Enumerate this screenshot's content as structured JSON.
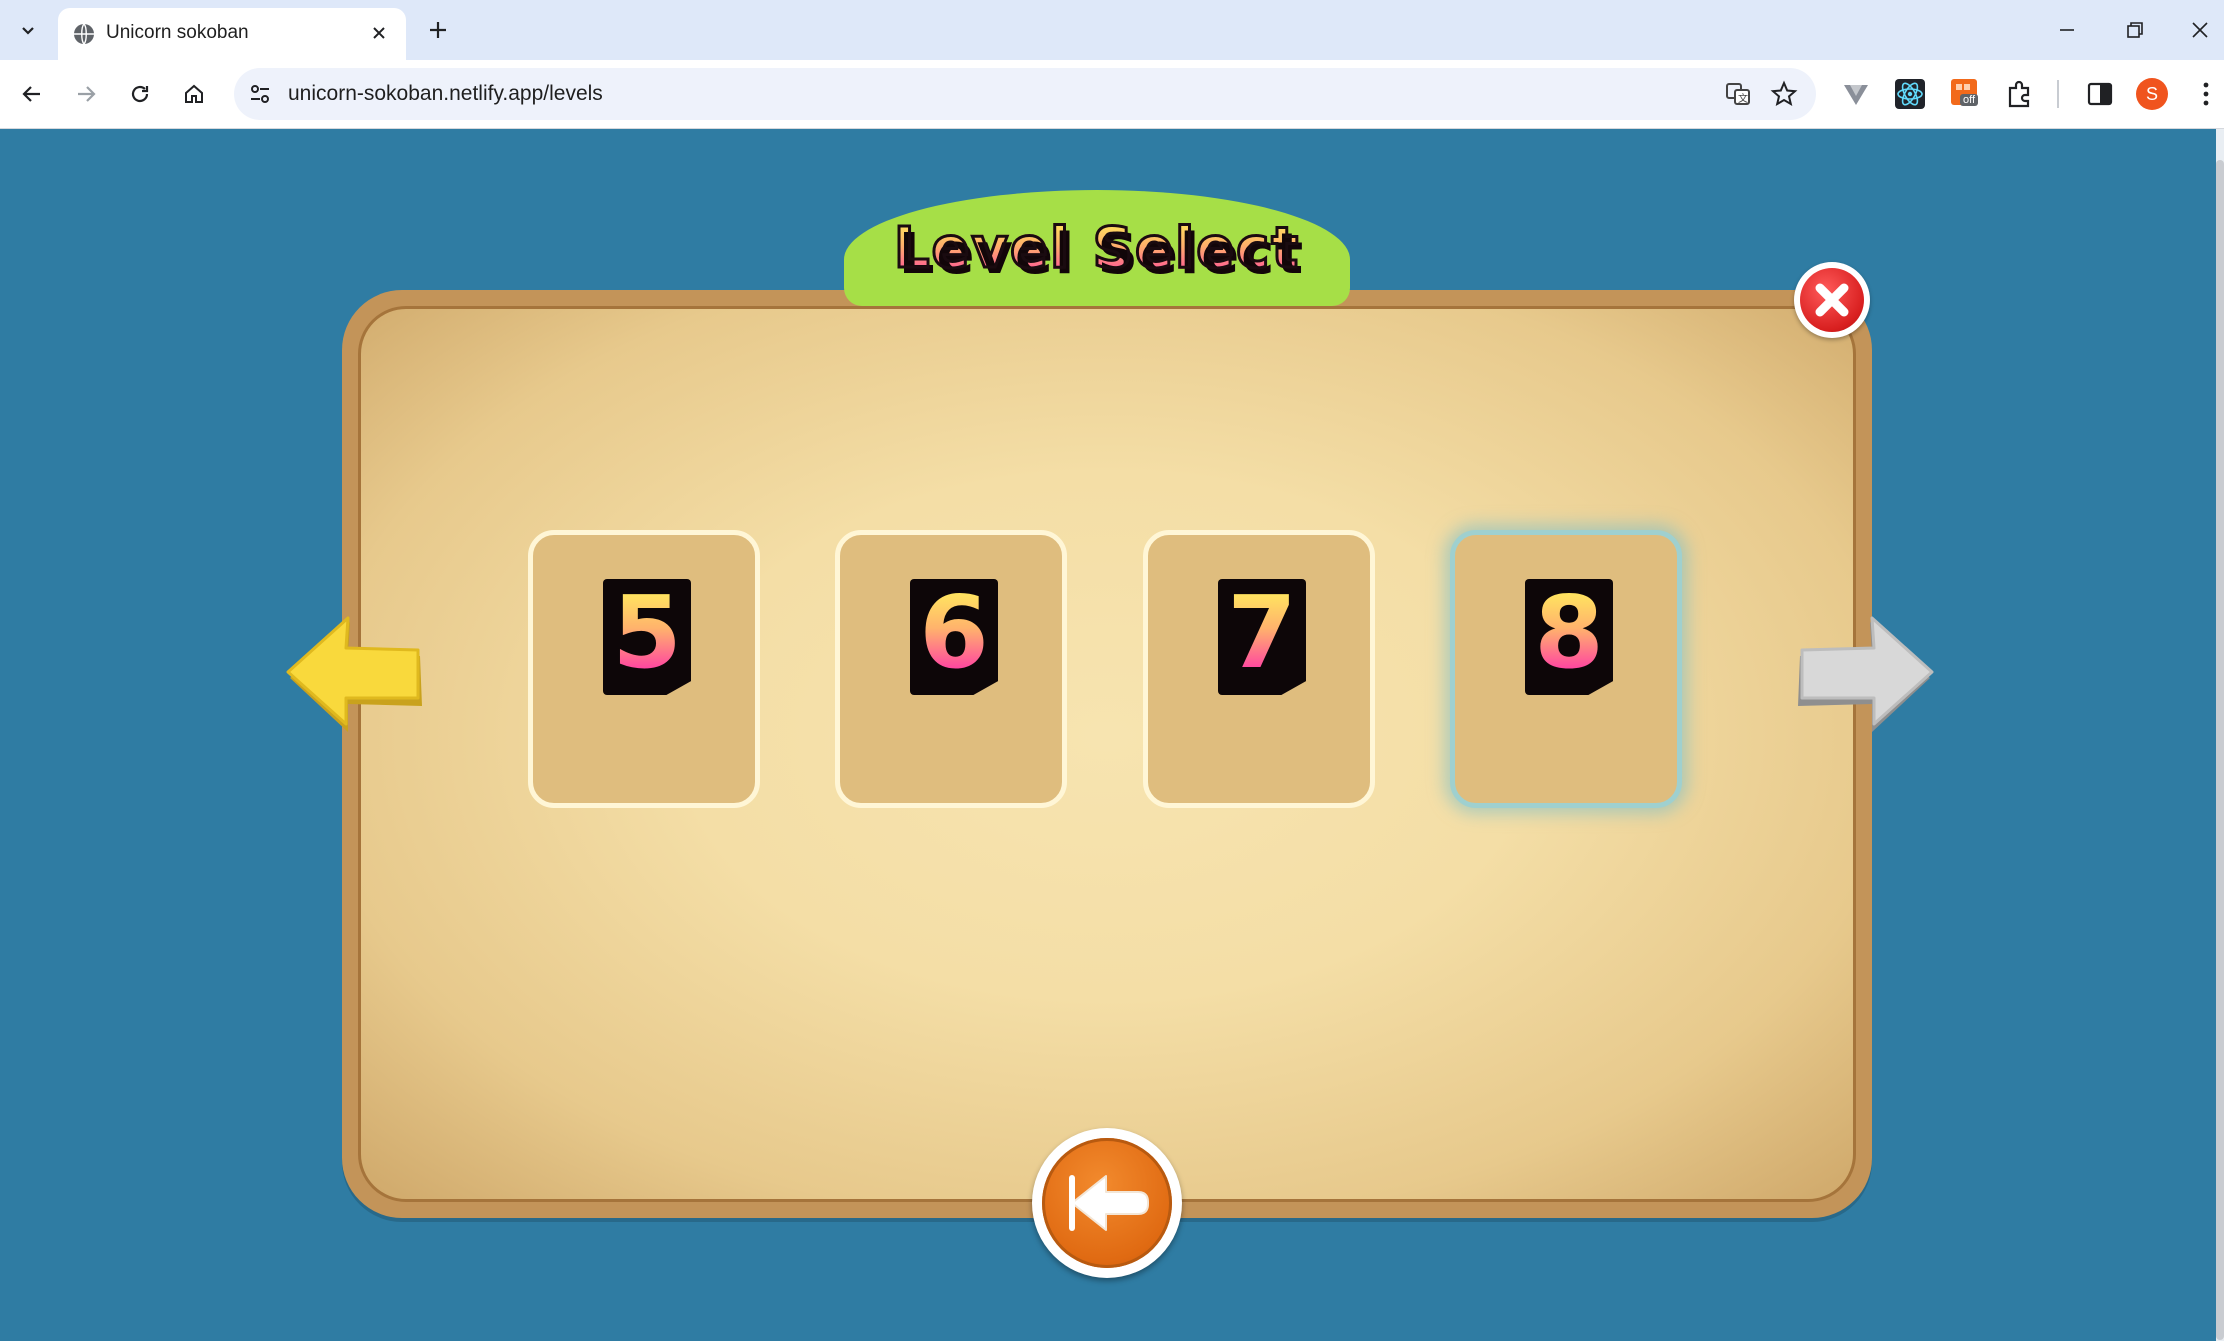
{
  "browser": {
    "tab": {
      "title": "Unicorn sokoban"
    },
    "address": {
      "url": "unicorn-sokoban.netlify.app/levels"
    },
    "profile_initial": "S",
    "extension_badge": "off"
  },
  "game": {
    "title": "Level Select",
    "levels": [
      {
        "number": "5",
        "selected": false
      },
      {
        "number": "6",
        "selected": false
      },
      {
        "number": "7",
        "selected": false
      },
      {
        "number": "8",
        "selected": true
      }
    ],
    "colors": {
      "background": "#2f7ca3",
      "board": "#c39459",
      "banner": "#a6df47",
      "prev_arrow": "#f7d43a",
      "next_arrow": "#cfcfcf",
      "close_button": "#d81f1f",
      "back_button": "#e06a12"
    },
    "icons": {
      "close": "close-x-icon",
      "prev": "arrow-left-icon",
      "next": "arrow-right-icon",
      "back": "rewind-back-icon"
    }
  }
}
